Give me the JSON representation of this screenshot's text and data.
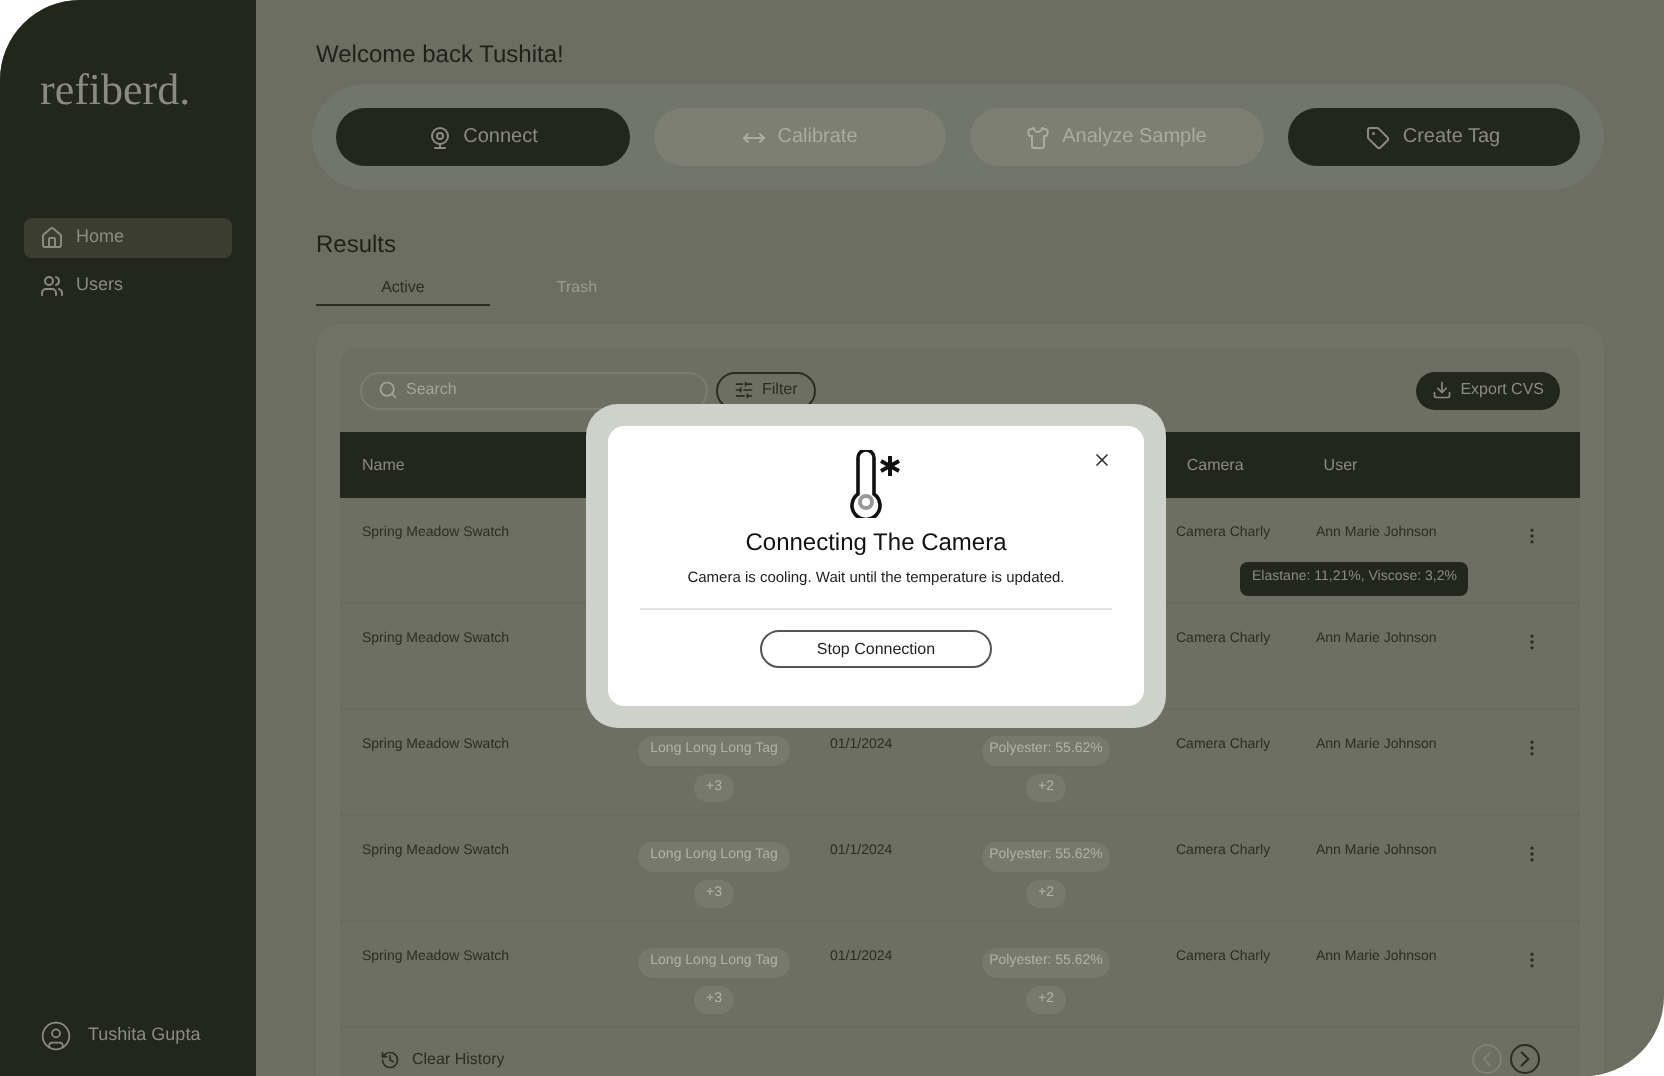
{
  "sidebar": {
    "logo": "refiberd.",
    "items": [
      {
        "label": "Home",
        "selected": true
      },
      {
        "label": "Users",
        "selected": false
      }
    ],
    "user": "Tushita Gupta"
  },
  "greeting": "Welcome back Tushita!",
  "actions": [
    {
      "label": "Connect",
      "disabled": false
    },
    {
      "label": "Calibrate",
      "disabled": true
    },
    {
      "label": "Analyze Sample",
      "disabled": true
    },
    {
      "label": "Create Tag",
      "disabled": false
    }
  ],
  "results": {
    "title": "Results",
    "tabs": [
      {
        "label": "Active",
        "selected": true
      },
      {
        "label": "Trash",
        "selected": false
      }
    ],
    "search": {
      "placeholder": "Search"
    },
    "filter": "Filter",
    "export": "Export CVS",
    "columns": [
      "Name",
      "Camera",
      "User"
    ],
    "rows": [
      {
        "name": "Spring Meadow Swatch",
        "camera": "Camera Charly",
        "user": "Ann Marie Johnson"
      },
      {
        "name": "Spring Meadow Swatch",
        "camera": "Camera Charly",
        "user": "Ann Marie Johnson"
      },
      {
        "name": "Spring Meadow Swatch",
        "tag": "Long Long Long Tag",
        "tag_more": "+3",
        "date": "01/1/2024",
        "composition": "Polyester: 55.62%",
        "composition_more": "+2",
        "camera": "Camera Charly",
        "user": "Ann Marie Johnson"
      },
      {
        "name": "Spring Meadow Swatch",
        "tag": "Long Long Long Tag",
        "tag_more": "+3",
        "date": "01/1/2024",
        "composition": "Polyester: 55.62%",
        "composition_more": "+2",
        "camera": "Camera Charly",
        "user": "Ann Marie Johnson"
      },
      {
        "name": "Spring Meadow Swatch",
        "tag": "Long Long Long Tag",
        "tag_more": "+3",
        "date": "01/1/2024",
        "composition": "Polyester: 55.62%",
        "composition_more": "+2",
        "camera": "Camera Charly",
        "user": "Ann Marie Johnson"
      }
    ],
    "tooltip": "Elastane: 11,21%, Viscose: 3,2%",
    "clear_history": "Clear History"
  },
  "dialog": {
    "title": "Connecting The Camera",
    "message": "Camera is cooling. Wait until the temperature is updated.",
    "button": "Stop Connection"
  }
}
